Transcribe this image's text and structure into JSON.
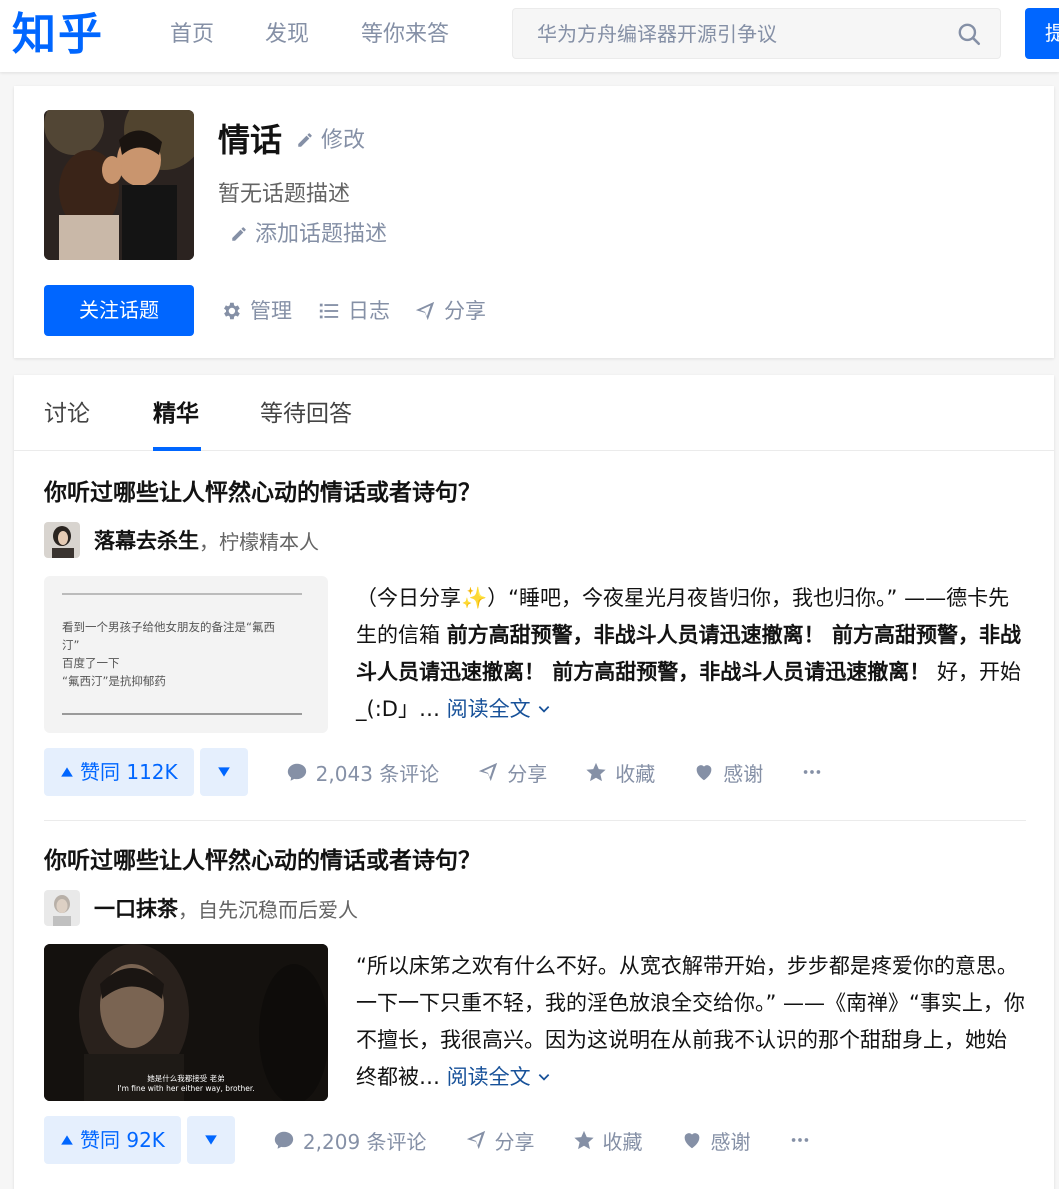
{
  "header": {
    "logo": "知乎",
    "nav": [
      "首页",
      "发现",
      "等你来答"
    ],
    "search_placeholder": "华为方舟编译器开源引争议",
    "ask_label": "提问"
  },
  "topic": {
    "title": "情话",
    "edit_label": "修改",
    "description": "暂无话题描述",
    "add_description_label": "添加话题描述",
    "follow_label": "关注话题",
    "actions": {
      "manage": "管理",
      "log": "日志",
      "share": "分享"
    }
  },
  "tabs": [
    "讨论",
    "精华",
    "等待回答"
  ],
  "feed": [
    {
      "question": "你听过哪些让人怦然心动的情话或者诗句？",
      "author": "落幕去杀生",
      "bio": "，柠檬精本人",
      "thumb_lines": [
        "看到一个男孩子给他女朋友的备注是“氟西",
        "汀”",
        "百度了一下",
        "“氟西汀”是抗抑郁药"
      ],
      "excerpt_plain1": "（今日分享✨）“睡吧，今夜星光月夜皆归你，我也归你。” ——德卡先生的信箱 ",
      "excerpt_bold": "前方高甜预警，非战斗人员请迅速撤离！ 前方高甜预警，非战斗人员请迅速撤离！ 前方高甜预警，非战斗人员请迅速撤离！",
      "excerpt_plain2": " 好，开始_(:D」… ",
      "read_more": "阅读全文",
      "votes": "赞同 112K",
      "comments": "2,043 条评论",
      "share": "分享",
      "collect": "收藏",
      "thanks": "感谢"
    },
    {
      "question": "你听过哪些让人怦然心动的情话或者诗句？",
      "author": "一口抹茶",
      "bio": "，自先沉稳而后爱人",
      "subtitle_cn": "她是什么我都接受 老弟",
      "subtitle_en": "I'm fine with her either way, brother.",
      "excerpt_plain1": "“所以床笫之欢有什么不好。从宽衣解带开始，步步都是疼爱你的意思。一下一下只重不轻，我的淫色放浪全交给你。” ——《南禅》“事实上，你不擅长，我很高兴。因为这说明在从前我不认识的那个甜甜身上，她始终都被… ",
      "read_more": "阅读全文",
      "votes": "赞同 92K",
      "comments": "2,209 条评论",
      "share": "分享",
      "collect": "收藏",
      "thanks": "感谢"
    }
  ],
  "colors": {
    "brand": "#0066ff",
    "muted": "#8590a6",
    "link": "#175199"
  }
}
